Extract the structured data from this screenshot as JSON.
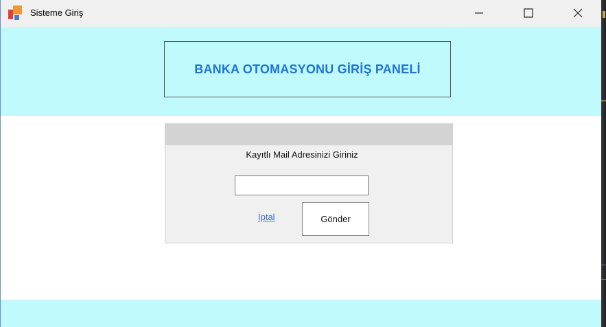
{
  "window": {
    "title": "Sisteme Giriş"
  },
  "header": {
    "title": "BANKA OTOMASYONU GİRİŞ PANELİ"
  },
  "form": {
    "label": "Kayıtlı Mail Adresinizi Giriniz",
    "email_value": "",
    "cancel_label": "İptal",
    "send_label": "Gönder"
  },
  "colors": {
    "band": "#c0fafd",
    "title_text": "#1f74d6",
    "panel_bg": "#f0f0f0",
    "panel_header": "#d3d3d3",
    "link": "#2a6fd6"
  },
  "icons": {
    "app": "app-logo-icon",
    "minimize": "minimize-icon",
    "maximize": "maximize-icon",
    "close": "close-icon"
  }
}
